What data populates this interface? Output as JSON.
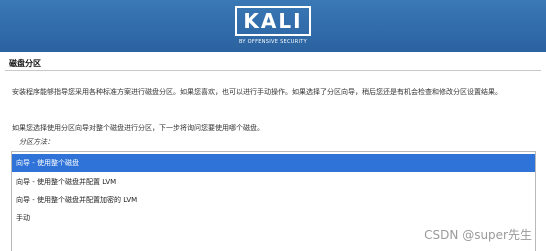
{
  "header": {
    "logo_text": "KALI",
    "logo_subtitle": "BY OFFENSIVE SECURITY",
    "colors": {
      "banner": "#2f6aa6",
      "selection": "#2f73d8"
    }
  },
  "page": {
    "title": "磁盘分区",
    "description": "安装程序能够指导您采用各种标准方案进行磁盘分区。如果您喜欢，也可以进行手动操作。如果选择了分区向导，稍后您还是有机会检查和修改分区设置结果。",
    "prompt": "如果您选择使用分区向导对整个磁盘进行分区，下一步将询问您要使用哪个磁盘。",
    "method_label": "分区方法："
  },
  "options": [
    {
      "label": "向导 - 使用整个磁盘",
      "selected": true
    },
    {
      "label": "向导 - 使用整个磁盘并配置 LVM",
      "selected": false
    },
    {
      "label": "向导 - 使用整个磁盘并配置加密的 LVM",
      "selected": false
    },
    {
      "label": "手动",
      "selected": false
    }
  ],
  "watermark": "CSDN @super先生"
}
